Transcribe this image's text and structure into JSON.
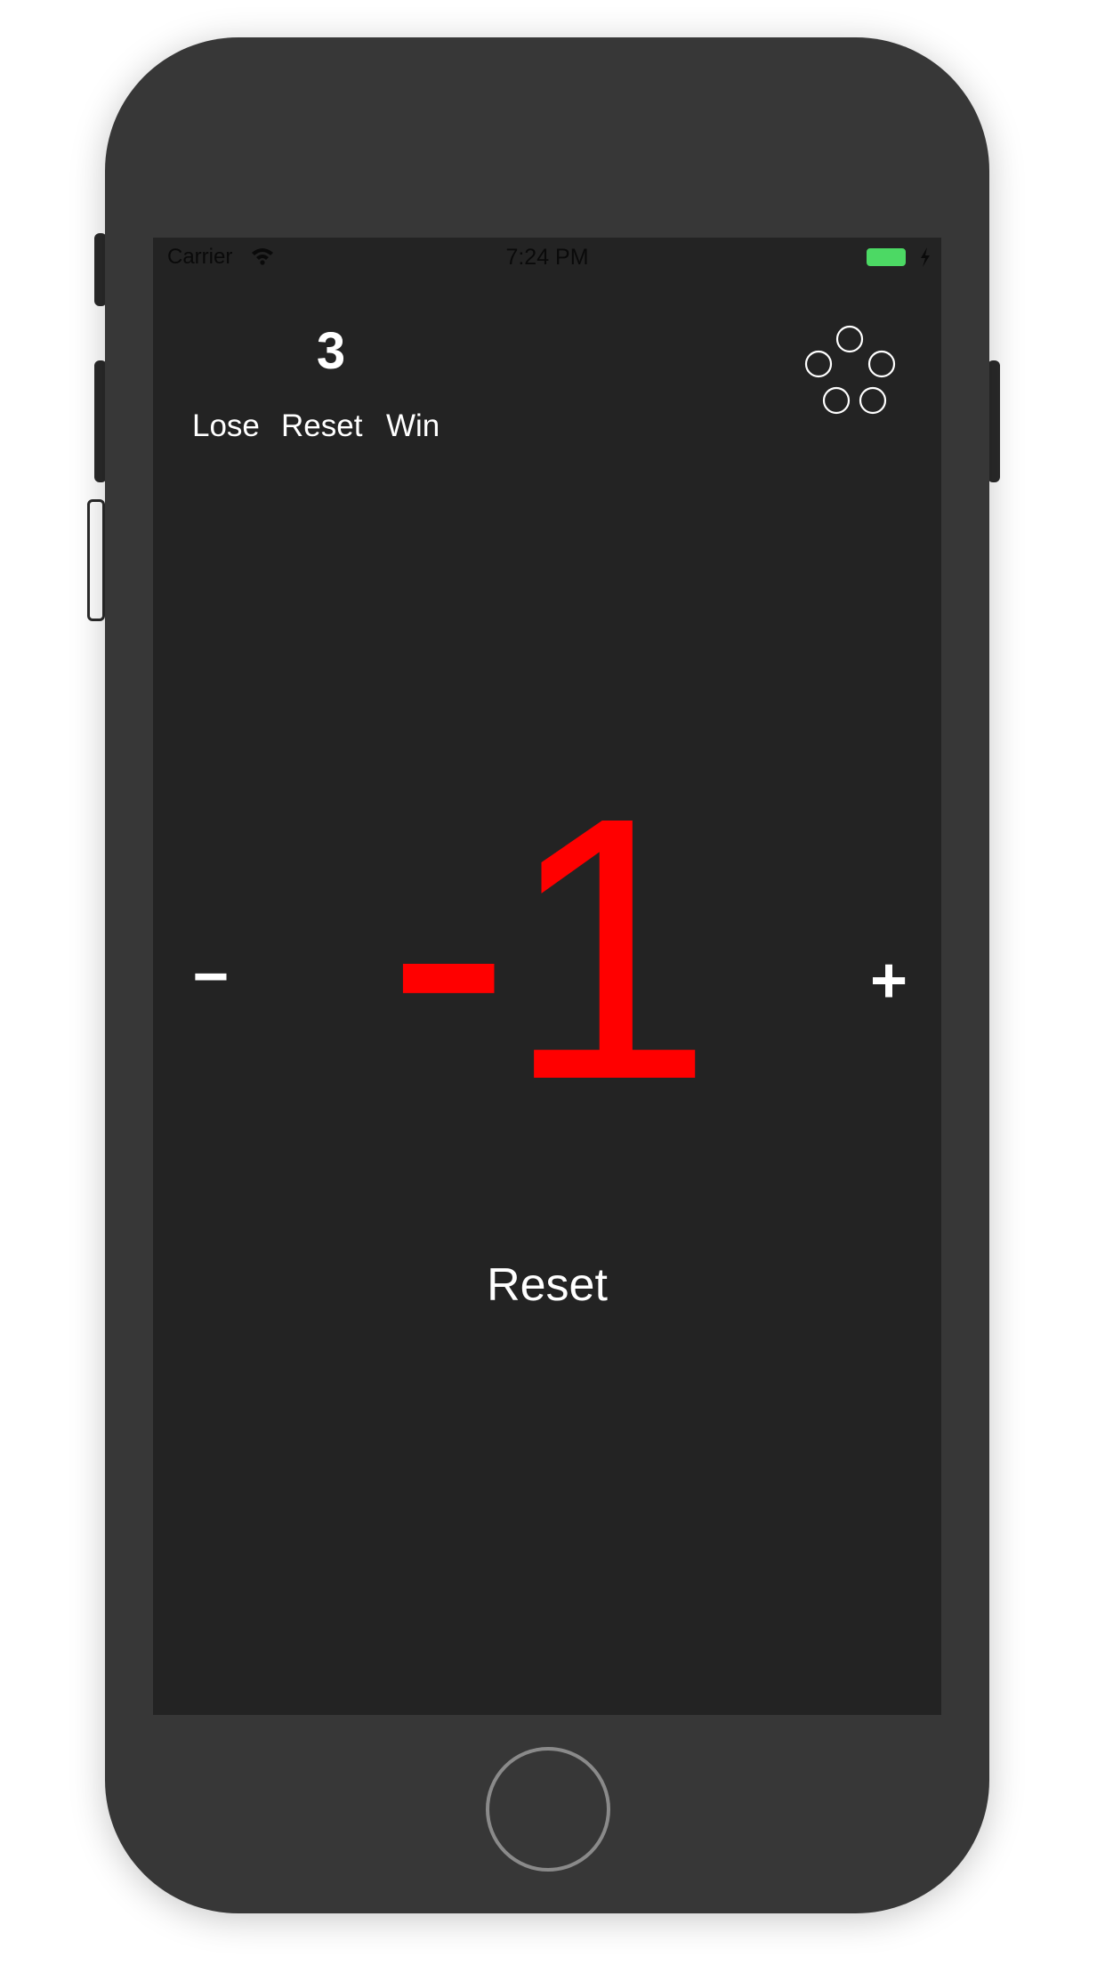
{
  "status_bar": {
    "carrier": "Carrier",
    "time": "7:24 PM",
    "battery_color": "#4cd964"
  },
  "score": {
    "value": "3",
    "lose_label": "Lose",
    "reset_label": "Reset",
    "win_label": "Win"
  },
  "counter": {
    "value": "-1",
    "value_color": "#ff0000",
    "minus_label": "−",
    "plus_label": "+"
  },
  "reset_button_label": "Reset",
  "icons": {
    "menu": "five-circles-icon",
    "wifi": "wifi-icon",
    "battery": "battery-icon",
    "charging": "bolt-icon"
  }
}
